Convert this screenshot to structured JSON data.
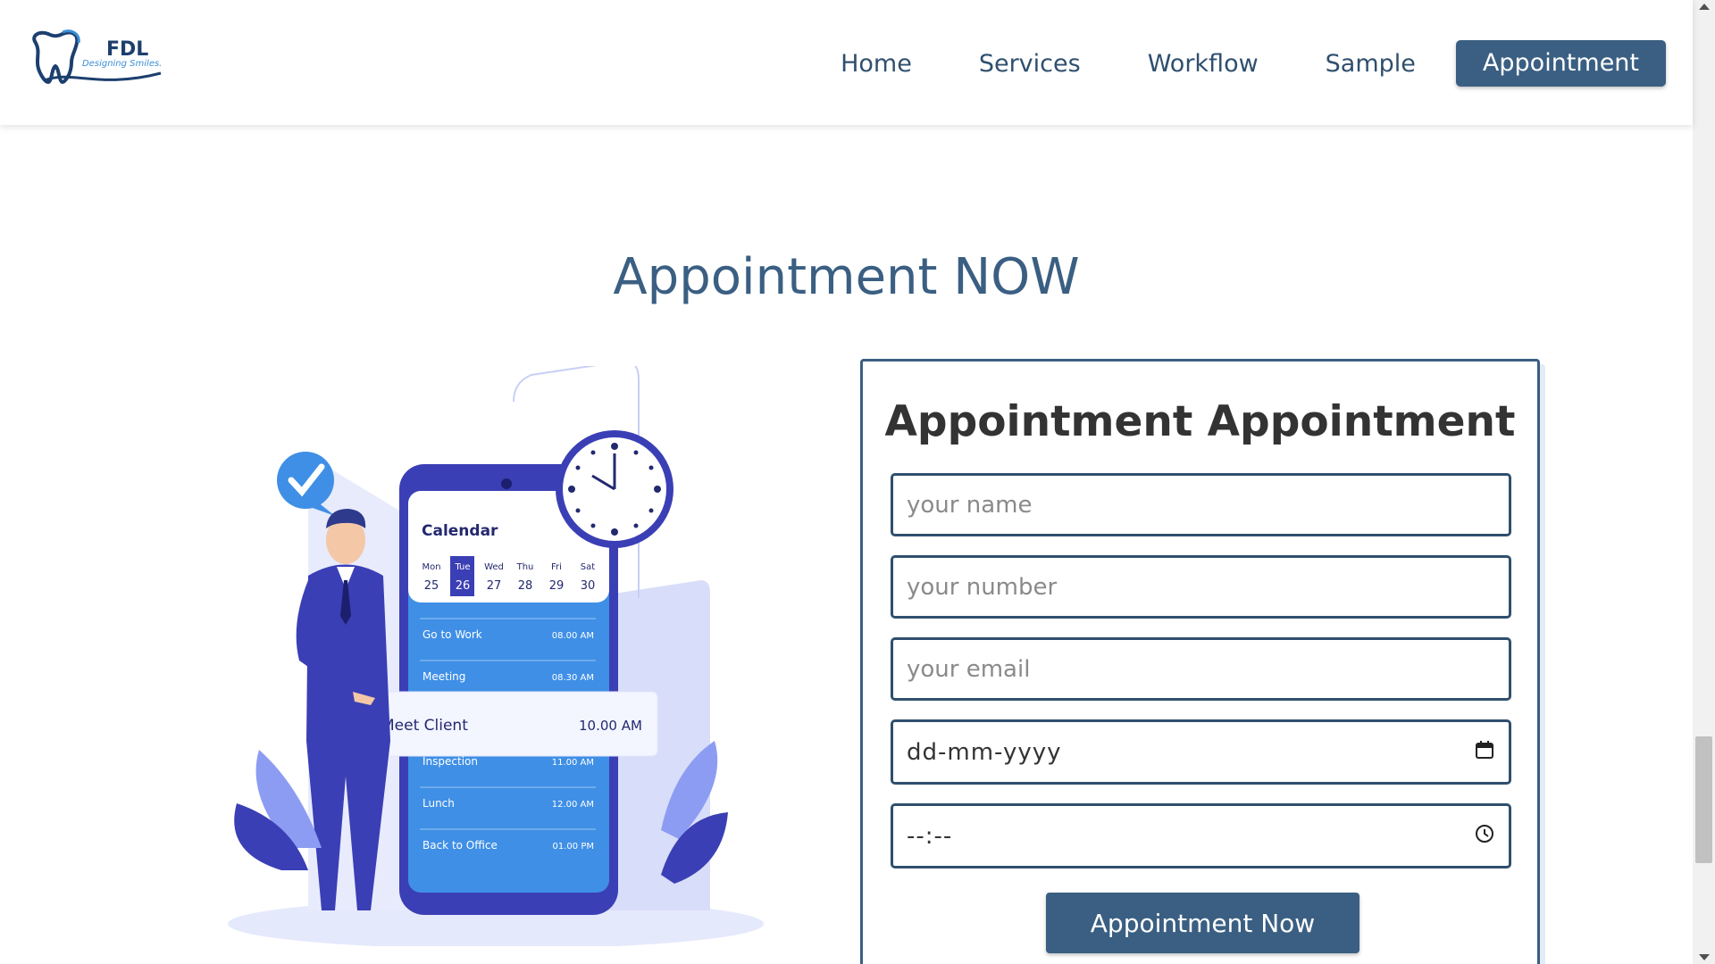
{
  "brand": {
    "name": "FDL",
    "tagline": "Designing Smiles."
  },
  "nav": {
    "items": [
      "Home",
      "Services",
      "Workflow",
      "Sample"
    ],
    "cta": "Appointment"
  },
  "section": {
    "title": "Appointment NOW"
  },
  "illustration": {
    "calendar_title": "Calendar",
    "days": [
      {
        "day": "Mon",
        "date": "25"
      },
      {
        "day": "Tue",
        "date": "26"
      },
      {
        "day": "Wed",
        "date": "27"
      },
      {
        "day": "Thu",
        "date": "28"
      },
      {
        "day": "Fri",
        "date": "29"
      },
      {
        "day": "Sat",
        "date": "30"
      }
    ],
    "events": [
      {
        "name": "Go to Work",
        "time": "08.00 AM"
      },
      {
        "name": "Meeting",
        "time": "08.30 AM"
      },
      {
        "name": "Inspection",
        "time": "11.00 AM"
      },
      {
        "name": "Lunch",
        "time": "12.00 AM"
      },
      {
        "name": "Back to Office",
        "time": "01.00 PM"
      }
    ],
    "highlight": {
      "name": "Meet Client",
      "time": "10.00 AM"
    }
  },
  "form": {
    "title": "Appointment Appointment",
    "name_placeholder": "your name",
    "number_placeholder": "your number",
    "email_placeholder": "your email",
    "date_value": "dd-mm-yyyy",
    "time_value": "--:--",
    "submit_label": "Appointment Now"
  },
  "colors": {
    "primary": "#3a5f82",
    "illustration_blue": "#4a5fd8"
  }
}
